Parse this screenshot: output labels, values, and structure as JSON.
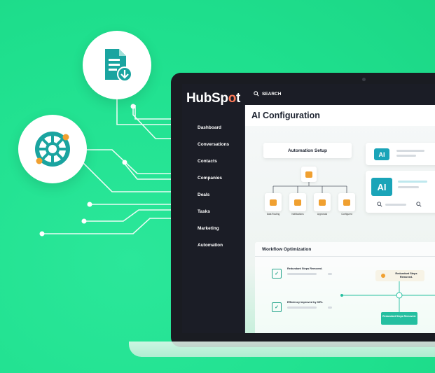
{
  "brand": {
    "logo_text_a": "HubSp",
    "logo_text_b": "o",
    "logo_text_c": "t"
  },
  "search": {
    "label": "SEARCH"
  },
  "sidebar": {
    "items": [
      {
        "label": "Dashboard"
      },
      {
        "label": "Conversations"
      },
      {
        "label": "Contacts"
      },
      {
        "label": "Companies"
      },
      {
        "label": "Deals"
      },
      {
        "label": "Tasks"
      },
      {
        "label": "Marketing"
      },
      {
        "label": "Automation"
      }
    ]
  },
  "page": {
    "title": "AI Configuration"
  },
  "automation_setup": {
    "label": "Automation Setup",
    "leaves": [
      "Data Routing",
      "Notifications",
      "Approvals",
      "Configured"
    ]
  },
  "ai_cards": [
    {
      "badge": "AI"
    },
    {
      "badge": "AI"
    }
  ],
  "workflow": {
    "title": "Workflow Optimization",
    "row1_text": "Redundant Steps Removed.",
    "row2_text": "Efficiency improved by 35%.",
    "pill_text": "Redundant Steps Removed.",
    "green_text": "Redundant Steps Removed."
  },
  "colors": {
    "background": "#1fe08e",
    "sidebar": "#1b1d26",
    "accent_orange": "#ff7a59",
    "ai_teal": "#1aa4b8",
    "node_orange": "#f0a030",
    "workflow_green": "#25bfa0"
  },
  "icons": {
    "doc_badge": "document-download-icon",
    "wheel_badge": "integration-wheel-icon",
    "search": "search-icon"
  }
}
